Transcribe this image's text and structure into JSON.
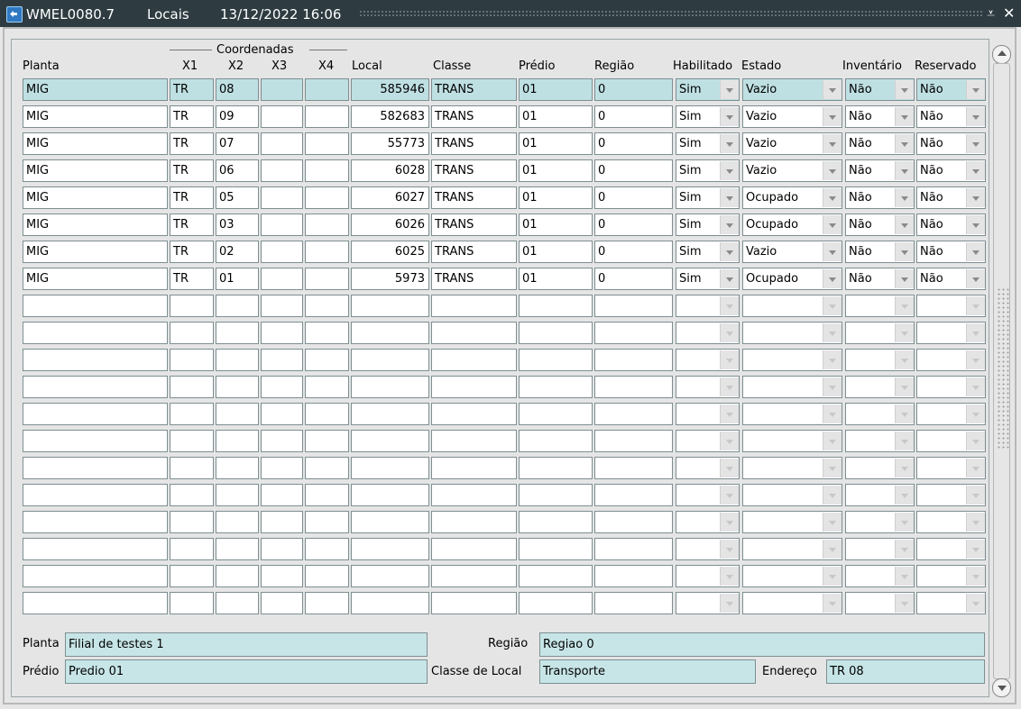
{
  "window": {
    "title_code": "WMEL0080.7",
    "title_name": "Locais",
    "title_datetime": "13/12/2022 16:06",
    "minimize_glyph": "⩡",
    "close_glyph": "✕"
  },
  "table": {
    "group_header": "Coordenadas",
    "columns": {
      "planta": "Planta",
      "x1": "X1",
      "x2": "X2",
      "x3": "X3",
      "x4": "X4",
      "local": "Local",
      "classe": "Classe",
      "predio": "Prédio",
      "regiao": "Região",
      "habilitado": "Habilitado",
      "estado": "Estado",
      "inventario": "Inventário",
      "reservado": "Reservado"
    },
    "rows": [
      {
        "planta": "MIG",
        "x1": "TR",
        "x2": "08",
        "x3": "",
        "x4": "",
        "local": "585946",
        "classe": "TRANS",
        "predio": "01",
        "regiao": "0",
        "habilitado": "Sim",
        "estado": "Vazio",
        "inventario": "Não",
        "reservado": "Não"
      },
      {
        "planta": "MIG",
        "x1": "TR",
        "x2": "09",
        "x3": "",
        "x4": "",
        "local": "582683",
        "classe": "TRANS",
        "predio": "01",
        "regiao": "0",
        "habilitado": "Sim",
        "estado": "Vazio",
        "inventario": "Não",
        "reservado": "Não"
      },
      {
        "planta": "MIG",
        "x1": "TR",
        "x2": "07",
        "x3": "",
        "x4": "",
        "local": "55773",
        "classe": "TRANS",
        "predio": "01",
        "regiao": "0",
        "habilitado": "Sim",
        "estado": "Vazio",
        "inventario": "Não",
        "reservado": "Não"
      },
      {
        "planta": "MIG",
        "x1": "TR",
        "x2": "06",
        "x3": "",
        "x4": "",
        "local": "6028",
        "classe": "TRANS",
        "predio": "01",
        "regiao": "0",
        "habilitado": "Sim",
        "estado": "Vazio",
        "inventario": "Não",
        "reservado": "Não"
      },
      {
        "planta": "MIG",
        "x1": "TR",
        "x2": "05",
        "x3": "",
        "x4": "",
        "local": "6027",
        "classe": "TRANS",
        "predio": "01",
        "regiao": "0",
        "habilitado": "Sim",
        "estado": "Ocupado",
        "inventario": "Não",
        "reservado": "Não"
      },
      {
        "planta": "MIG",
        "x1": "TR",
        "x2": "03",
        "x3": "",
        "x4": "",
        "local": "6026",
        "classe": "TRANS",
        "predio": "01",
        "regiao": "0",
        "habilitado": "Sim",
        "estado": "Ocupado",
        "inventario": "Não",
        "reservado": "Não"
      },
      {
        "planta": "MIG",
        "x1": "TR",
        "x2": "02",
        "x3": "",
        "x4": "",
        "local": "6025",
        "classe": "TRANS",
        "predio": "01",
        "regiao": "0",
        "habilitado": "Sim",
        "estado": "Vazio",
        "inventario": "Não",
        "reservado": "Não"
      },
      {
        "planta": "MIG",
        "x1": "TR",
        "x2": "01",
        "x3": "",
        "x4": "",
        "local": "5973",
        "classe": "TRANS",
        "predio": "01",
        "regiao": "0",
        "habilitado": "Sim",
        "estado": "Ocupado",
        "inventario": "Não",
        "reservado": "Não"
      },
      {
        "planta": "",
        "x1": "",
        "x2": "",
        "x3": "",
        "x4": "",
        "local": "",
        "classe": "",
        "predio": "",
        "regiao": "",
        "habilitado": "",
        "estado": "",
        "inventario": "",
        "reservado": ""
      },
      {
        "planta": "",
        "x1": "",
        "x2": "",
        "x3": "",
        "x4": "",
        "local": "",
        "classe": "",
        "predio": "",
        "regiao": "",
        "habilitado": "",
        "estado": "",
        "inventario": "",
        "reservado": ""
      },
      {
        "planta": "",
        "x1": "",
        "x2": "",
        "x3": "",
        "x4": "",
        "local": "",
        "classe": "",
        "predio": "",
        "regiao": "",
        "habilitado": "",
        "estado": "",
        "inventario": "",
        "reservado": ""
      },
      {
        "planta": "",
        "x1": "",
        "x2": "",
        "x3": "",
        "x4": "",
        "local": "",
        "classe": "",
        "predio": "",
        "regiao": "",
        "habilitado": "",
        "estado": "",
        "inventario": "",
        "reservado": ""
      },
      {
        "planta": "",
        "x1": "",
        "x2": "",
        "x3": "",
        "x4": "",
        "local": "",
        "classe": "",
        "predio": "",
        "regiao": "",
        "habilitado": "",
        "estado": "",
        "inventario": "",
        "reservado": ""
      },
      {
        "planta": "",
        "x1": "",
        "x2": "",
        "x3": "",
        "x4": "",
        "local": "",
        "classe": "",
        "predio": "",
        "regiao": "",
        "habilitado": "",
        "estado": "",
        "inventario": "",
        "reservado": ""
      },
      {
        "planta": "",
        "x1": "",
        "x2": "",
        "x3": "",
        "x4": "",
        "local": "",
        "classe": "",
        "predio": "",
        "regiao": "",
        "habilitado": "",
        "estado": "",
        "inventario": "",
        "reservado": ""
      },
      {
        "planta": "",
        "x1": "",
        "x2": "",
        "x3": "",
        "x4": "",
        "local": "",
        "classe": "",
        "predio": "",
        "regiao": "",
        "habilitado": "",
        "estado": "",
        "inventario": "",
        "reservado": ""
      },
      {
        "planta": "",
        "x1": "",
        "x2": "",
        "x3": "",
        "x4": "",
        "local": "",
        "classe": "",
        "predio": "",
        "regiao": "",
        "habilitado": "",
        "estado": "",
        "inventario": "",
        "reservado": ""
      },
      {
        "planta": "",
        "x1": "",
        "x2": "",
        "x3": "",
        "x4": "",
        "local": "",
        "classe": "",
        "predio": "",
        "regiao": "",
        "habilitado": "",
        "estado": "",
        "inventario": "",
        "reservado": ""
      },
      {
        "planta": "",
        "x1": "",
        "x2": "",
        "x3": "",
        "x4": "",
        "local": "",
        "classe": "",
        "predio": "",
        "regiao": "",
        "habilitado": "",
        "estado": "",
        "inventario": "",
        "reservado": ""
      },
      {
        "planta": "",
        "x1": "",
        "x2": "",
        "x3": "",
        "x4": "",
        "local": "",
        "classe": "",
        "predio": "",
        "regiao": "",
        "habilitado": "",
        "estado": "",
        "inventario": "",
        "reservado": ""
      }
    ]
  },
  "details": {
    "planta_label": "Planta",
    "planta_value": "Filial de testes 1",
    "regiao_label": "Região",
    "regiao_value": "Regiao 0",
    "predio_label": "Prédio",
    "predio_value": "Predio 01",
    "classe_label": "Classe de Local",
    "classe_value": "Transporte",
    "endereco_label": "Endereço",
    "endereco_value": "TR 08"
  },
  "colors": {
    "titlebar_bg": "#2e3c42",
    "selected_row_bg": "#bfe0e3",
    "info_field_bg": "#c7e5e7",
    "panel_bg": "#e5e5e5"
  }
}
